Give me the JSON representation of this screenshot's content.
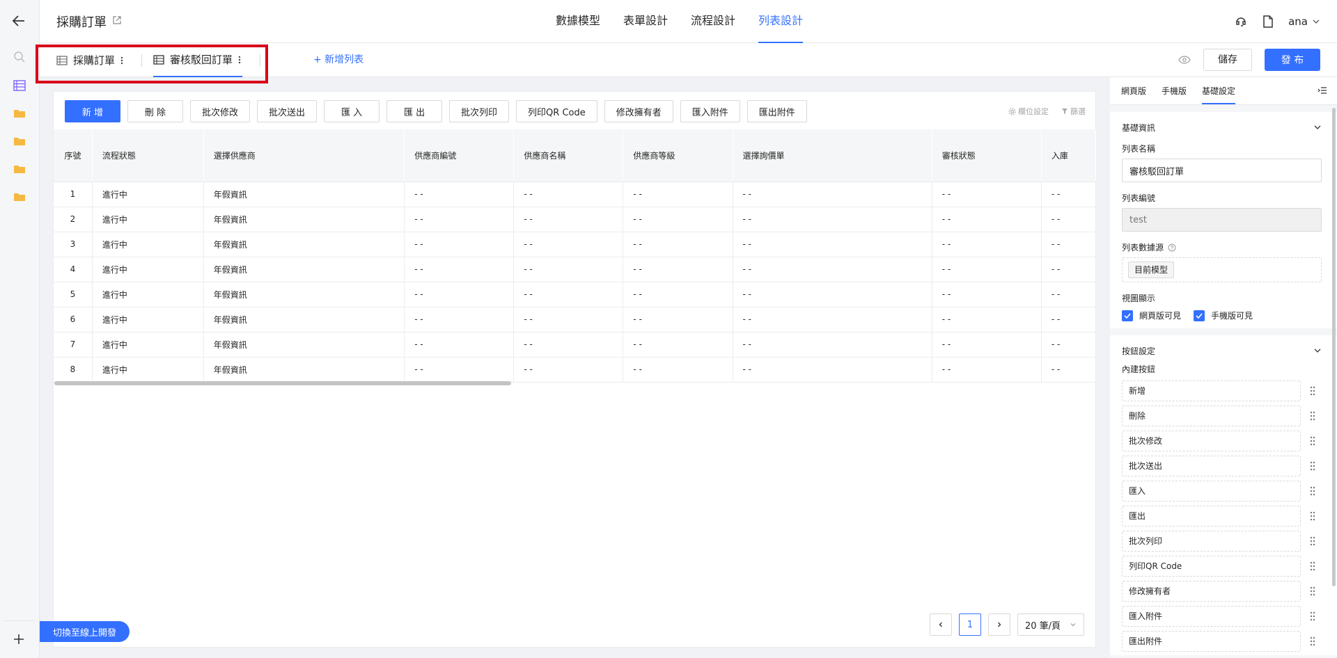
{
  "app": {
    "title": "採購訂單"
  },
  "topnav": {
    "tabs": [
      {
        "label": "數據模型",
        "active": false
      },
      {
        "label": "表單設計",
        "active": false
      },
      {
        "label": "流程設計",
        "active": false
      },
      {
        "label": "列表設計",
        "active": true
      }
    ]
  },
  "user": {
    "name": "ana"
  },
  "list_tabs": [
    {
      "label": "採購訂單",
      "active": false
    },
    {
      "label": "審核駁回訂單",
      "active": true
    }
  ],
  "add_list_label": "+ 新增列表",
  "header_actions": {
    "save": "儲存",
    "publish": "發 布"
  },
  "toolbar": {
    "buttons": [
      "新 增",
      "刪 除",
      "批次修改",
      "批次送出",
      "匯 入",
      "匯 出",
      "批次列印",
      "列印QR Code",
      "修改擁有者",
      "匯入附件",
      "匯出附件"
    ],
    "field_settings": "欄位設定",
    "filter": "篩選"
  },
  "table": {
    "columns": [
      "序號",
      "流程狀態",
      "選擇供應商",
      "供應商編號",
      "供應商名稱",
      "供應商等級",
      "選擇詢價單",
      "審核狀態",
      "入庫"
    ],
    "rows": [
      [
        "1",
        "進行中",
        "年假資訊",
        "- -",
        "- -",
        "- -",
        "- -",
        "- -",
        "- -"
      ],
      [
        "2",
        "進行中",
        "年假資訊",
        "- -",
        "- -",
        "- -",
        "- -",
        "- -",
        "- -"
      ],
      [
        "3",
        "進行中",
        "年假資訊",
        "- -",
        "- -",
        "- -",
        "- -",
        "- -",
        "- -"
      ],
      [
        "4",
        "進行中",
        "年假資訊",
        "- -",
        "- -",
        "- -",
        "- -",
        "- -",
        "- -"
      ],
      [
        "5",
        "進行中",
        "年假資訊",
        "- -",
        "- -",
        "- -",
        "- -",
        "- -",
        "- -"
      ],
      [
        "6",
        "進行中",
        "年假資訊",
        "- -",
        "- -",
        "- -",
        "- -",
        "- -",
        "- -"
      ],
      [
        "7",
        "進行中",
        "年假資訊",
        "- -",
        "- -",
        "- -",
        "- -",
        "- -",
        "- -"
      ],
      [
        "8",
        "進行中",
        "年假資訊",
        "- -",
        "- -",
        "- -",
        "- -",
        "- -",
        "- -"
      ]
    ]
  },
  "pagination": {
    "current": "1",
    "page_size": "20 筆/頁"
  },
  "switch_label": "切換至線上開發",
  "right_panel": {
    "tabs": [
      {
        "label": "網頁版",
        "active": false
      },
      {
        "label": "手機版",
        "active": false
      },
      {
        "label": "基礎設定",
        "active": true
      }
    ],
    "basic": {
      "title": "基礎資訊",
      "name_label": "列表名稱",
      "name_value": "審核駁回訂單",
      "code_label": "列表編號",
      "code_placeholder": "test",
      "source_label": "列表數據源",
      "source_value": "目前模型",
      "view_label": "視圖顯示",
      "web_visible": "網頁版可見",
      "mobile_visible": "手機版可見"
    },
    "buttons": {
      "title": "按鈕設定",
      "builtin_label": "內建按鈕",
      "items": [
        "新增",
        "刪除",
        "批次修改",
        "批次送出",
        "匯入",
        "匯出",
        "批次列印",
        "列印QR Code",
        "修改擁有者",
        "匯入附件",
        "匯出附件"
      ]
    }
  },
  "colors": {
    "accent": "#3370ff",
    "highlight": "#d9001b",
    "folder": "#f5b942"
  }
}
